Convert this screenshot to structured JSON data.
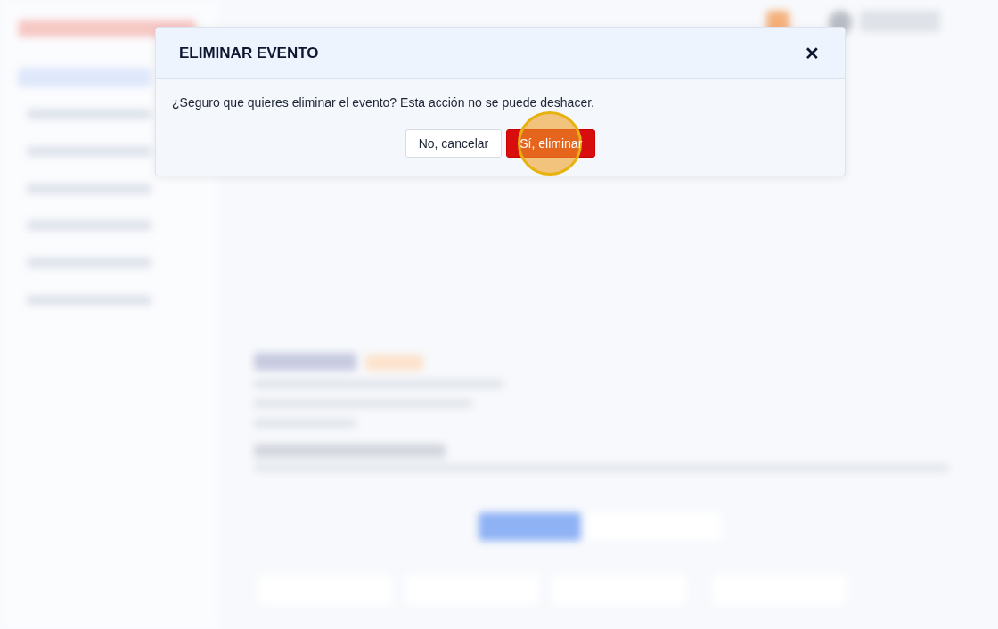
{
  "dialog": {
    "title": "ELIMINAR EVENTO",
    "close": "✕",
    "message": "¿Seguro que quieres eliminar el evento? Esta acción no se puede deshacer.",
    "buttons": [
      {
        "label": "No, cancelar",
        "kind": "secondary"
      },
      {
        "label": "Sí, eliminar",
        "kind": "danger",
        "highlighted": true
      }
    ]
  }
}
